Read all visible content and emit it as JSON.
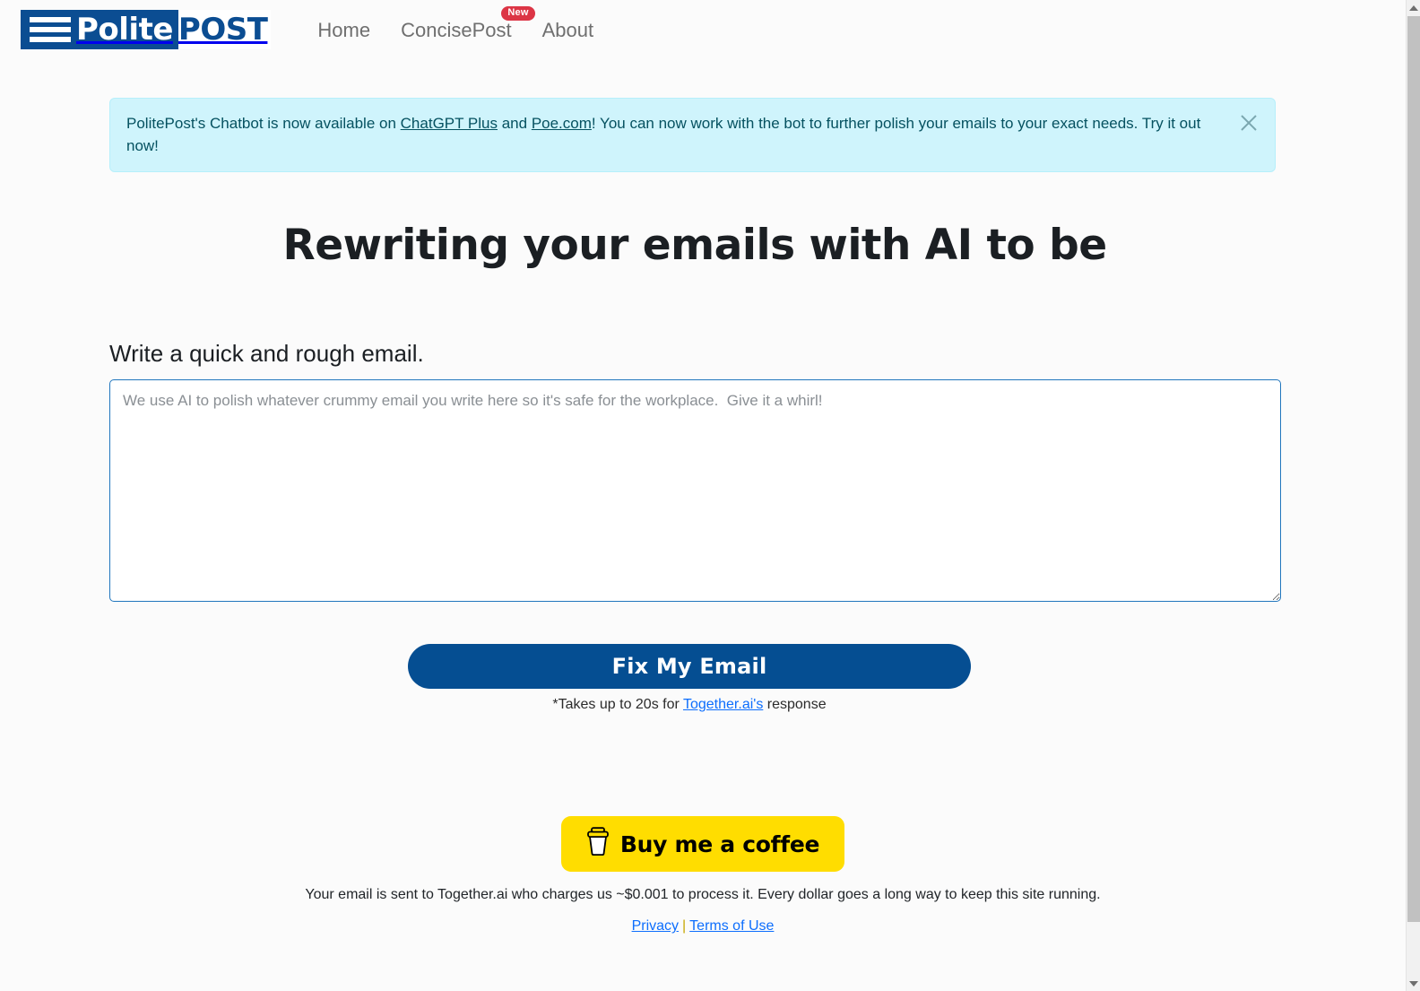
{
  "nav": {
    "logo": {
      "mark": "hamburger-lines",
      "text_primary": "Polite",
      "text_secondary": "POST"
    },
    "links": [
      {
        "label": "Home",
        "badge": null
      },
      {
        "label": "ConcisePost",
        "badge": "New"
      },
      {
        "label": "About",
        "badge": null
      }
    ]
  },
  "alert": {
    "text_part1": "PolitePost's Chatbot is now available on ",
    "link1": "ChatGPT Plus",
    "text_part2": " and ",
    "link2": "Poe.com",
    "text_part3": "! You can now work with the bot to further polish your emails to your exact needs. Try it out now!",
    "close_icon": "close-icon",
    "background_color": "#cff4fc",
    "text_color": "#055160"
  },
  "hero": {
    "heading": "Rewriting your emails with AI to be",
    "typed_word": ""
  },
  "form": {
    "label": "Write a quick and rough email.",
    "textarea_value": "",
    "textarea_placeholder": "We use AI to polish whatever crummy email you write here so it's safe for the workplace.  Give it a whirl!",
    "submit_label": "Fix My Email",
    "submit_color": "#054e92",
    "note_prefix": "*Takes up to 20s for ",
    "note_link": "Together.ai's",
    "note_suffix": " response"
  },
  "coffee": {
    "label": "Buy me a coffee",
    "icon": "coffee-cup-icon",
    "background_color": "#ffdd00"
  },
  "footer": {
    "note": "Your email is sent to Together.ai who charges us ~$0.001 to process it. Every dollar goes a long way to keep this site running.",
    "privacy_label": "Privacy",
    "separator": "|",
    "terms_label": "Terms of Use",
    "link_color": "#0d6efd"
  }
}
